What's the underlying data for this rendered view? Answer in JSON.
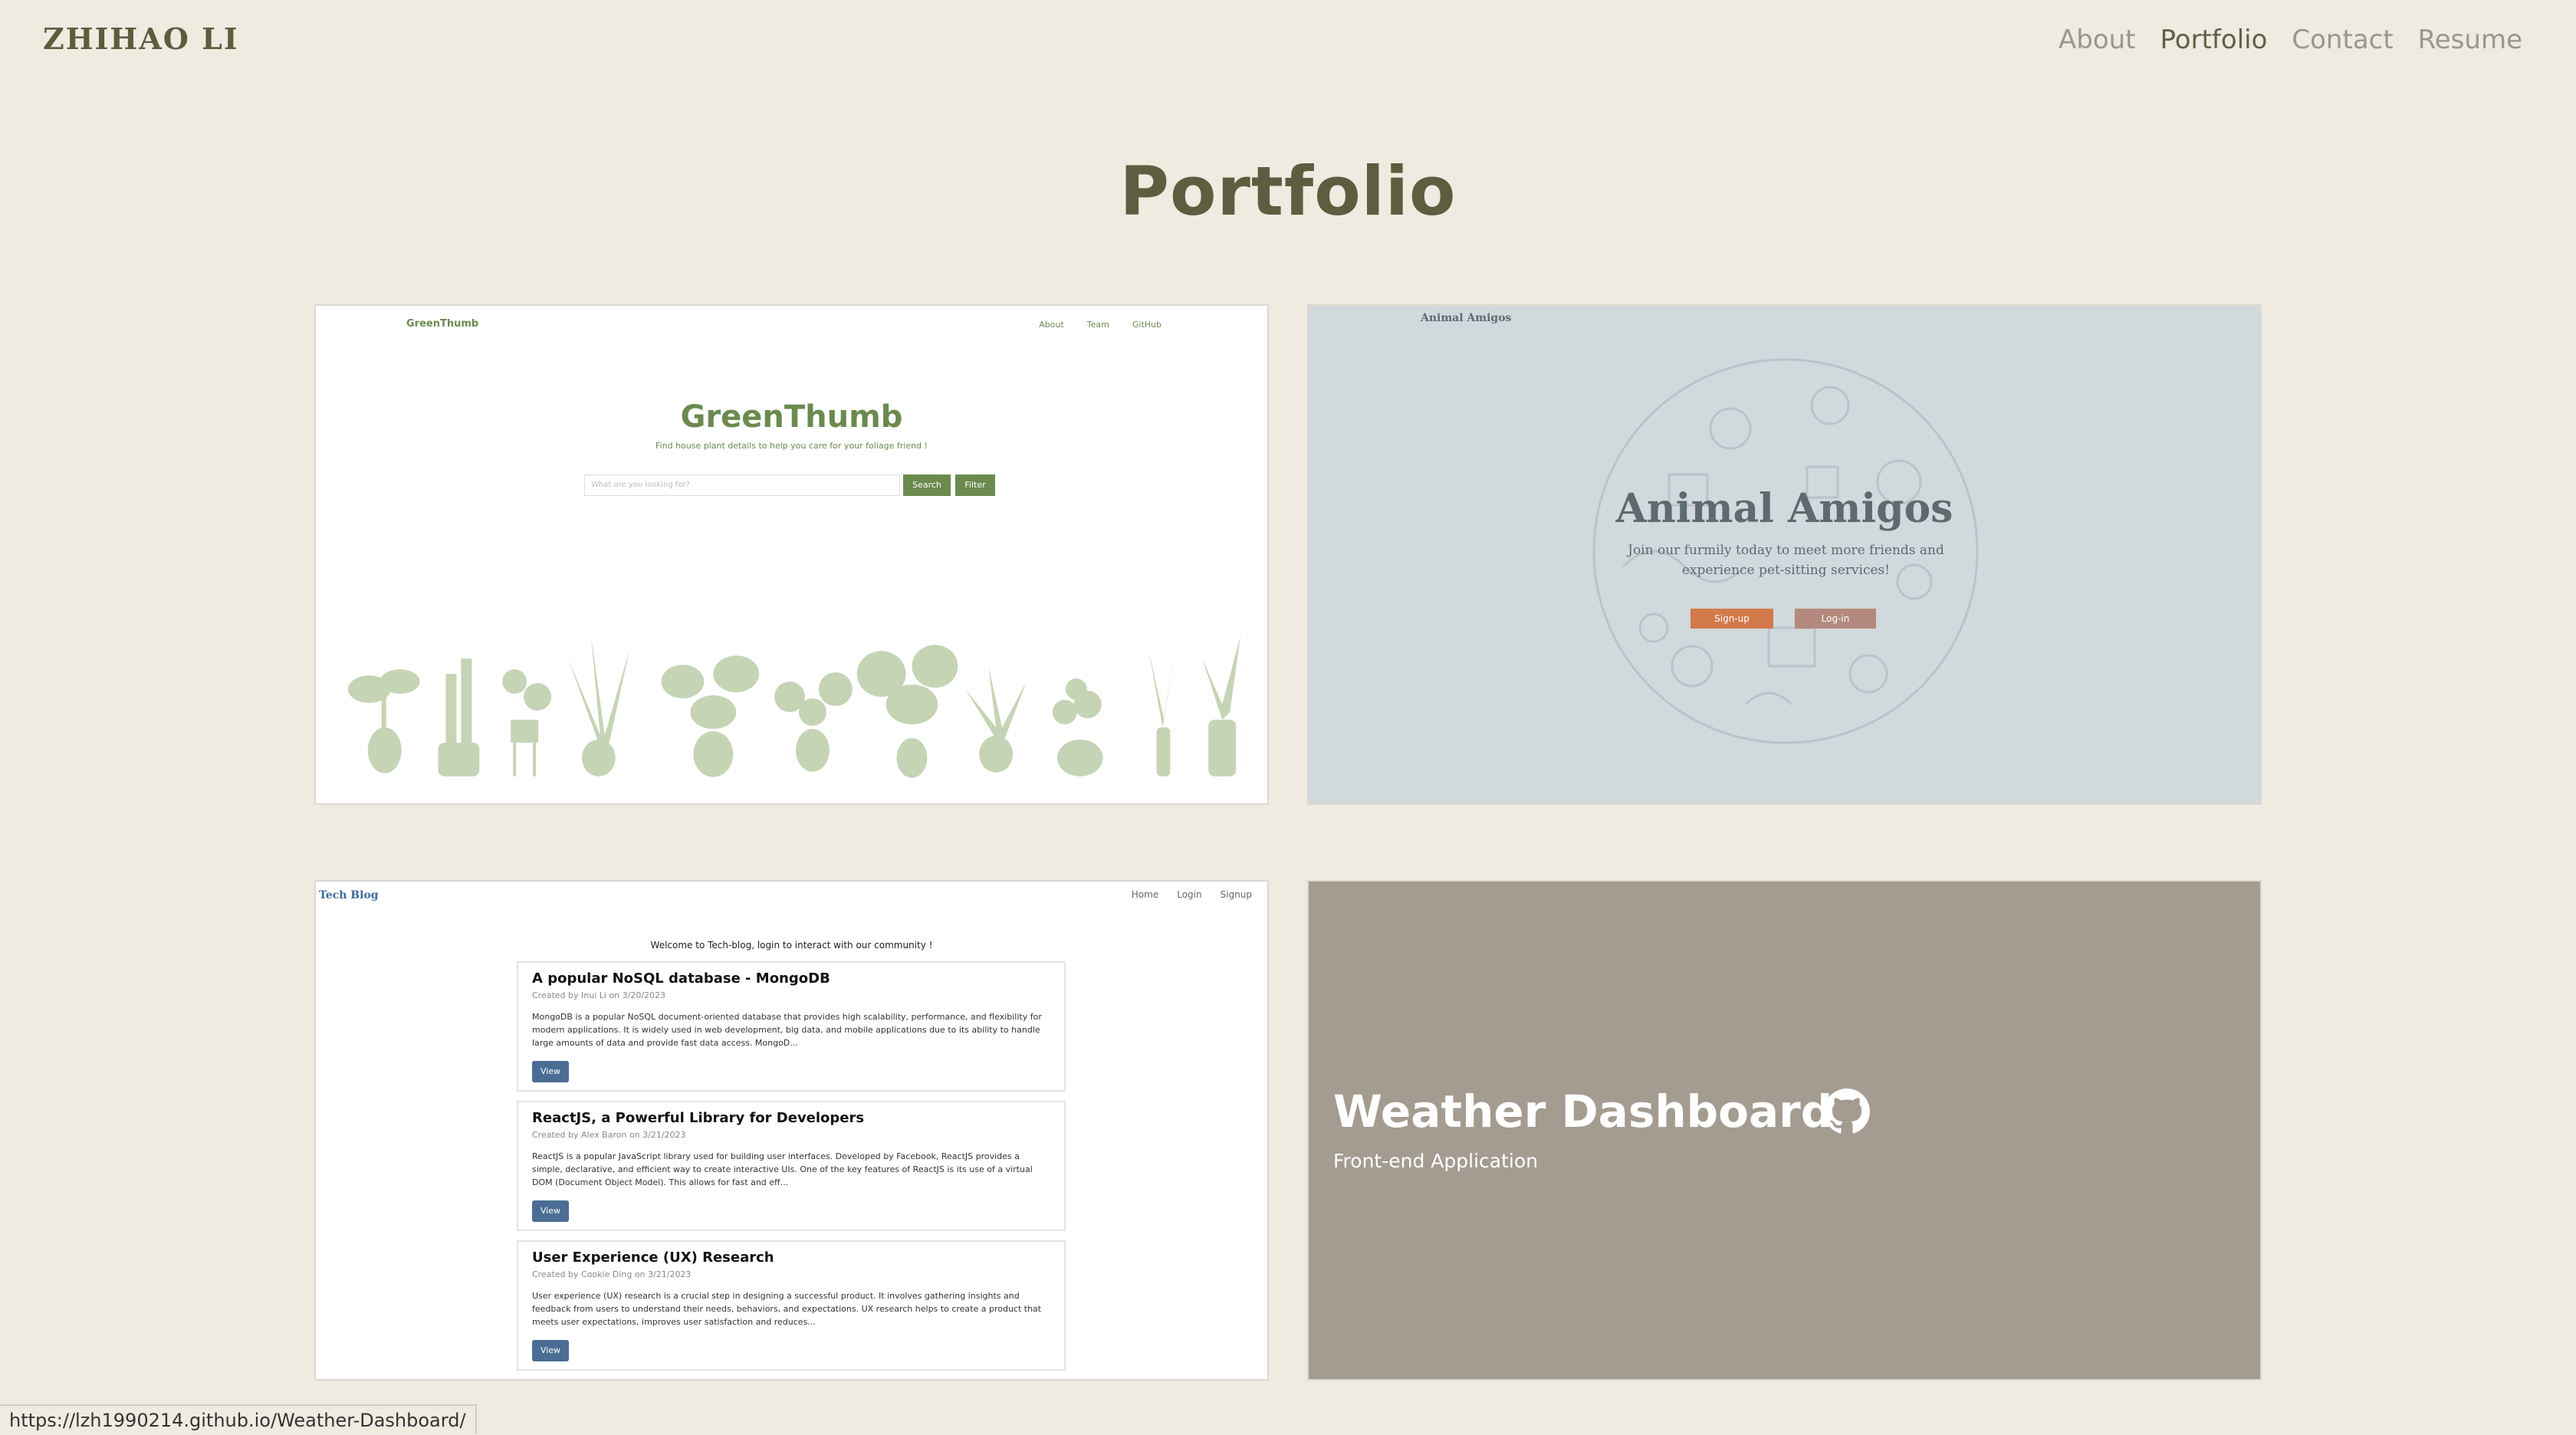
{
  "header": {
    "brand": "ZHIHAO LI",
    "nav": [
      "About",
      "Portfolio",
      "Contact",
      "Resume"
    ],
    "active_nav": "Portfolio"
  },
  "page_title": "Portfolio",
  "projects": {
    "green_thumb": {
      "logo": "GreenThumb",
      "nav": [
        "About",
        "Team",
        "GitHub"
      ],
      "title": "GreenThumb",
      "subtitle": "Find house plant details to help you care for your foliage friend !",
      "search_placeholder": "What are you looking for?",
      "search_button": "Search",
      "filter_button": "Filter"
    },
    "animal_amigos": {
      "logo": "Animal Amigos",
      "title": "Animal Amigos",
      "subtitle": "Join our furmily today to meet more friends and experience pet-sitting services!",
      "signup_button": "Sign-up",
      "login_button": "Log-in"
    },
    "tech_blog": {
      "logo": "Tech Blog",
      "nav": [
        "Home",
        "Login",
        "Signup"
      ],
      "welcome": "Welcome to Tech-blog, login to interact with our community !",
      "posts": [
        {
          "title": "A popular NoSQL database - MongoDB",
          "meta": "Created by Inui Li on 3/20/2023",
          "body": "MongoDB is a popular NoSQL document-oriented database that provides high scalability, performance, and flexibility for modern applications. It is widely used in web development, big data, and mobile applications due to its ability to handle large amounts of data and provide fast data access. MongoD...",
          "button": "View"
        },
        {
          "title": "ReactJS, a Powerful Library for Developers",
          "meta": "Created by Alex Baron on 3/21/2023",
          "body": "ReactJS is a popular JavaScript library used for building user interfaces. Developed by Facebook, ReactJS provides a simple, declarative, and efficient way to create interactive UIs. One of the key features of ReactJS is its use of a virtual DOM (Document Object Model). This allows for fast and eff...",
          "button": "View"
        },
        {
          "title": "User Experience (UX) Research",
          "meta": "Created by Cookie Ding on 3/21/2023",
          "body": "User experience (UX) research is a crucial step in designing a successful product. It involves gathering insights and feedback from users to understand their needs, behaviors, and expectations. UX research helps to create a product that meets user expectations, improves user satisfaction and reduces...",
          "button": "View"
        }
      ]
    },
    "weather_dashboard": {
      "title": "Weather Dashboard",
      "subtitle": "Front-end Application",
      "icon": "github-icon"
    }
  },
  "status_bar": {
    "url": "https://lzh1990214.github.io/Weather-Dashboard/"
  },
  "colors": {
    "background": "#efebe1",
    "brand": "#5c5e3f",
    "weather_card": "#a49b91",
    "animal_card": "#d1d9dc",
    "green": "#6b8a4e"
  }
}
